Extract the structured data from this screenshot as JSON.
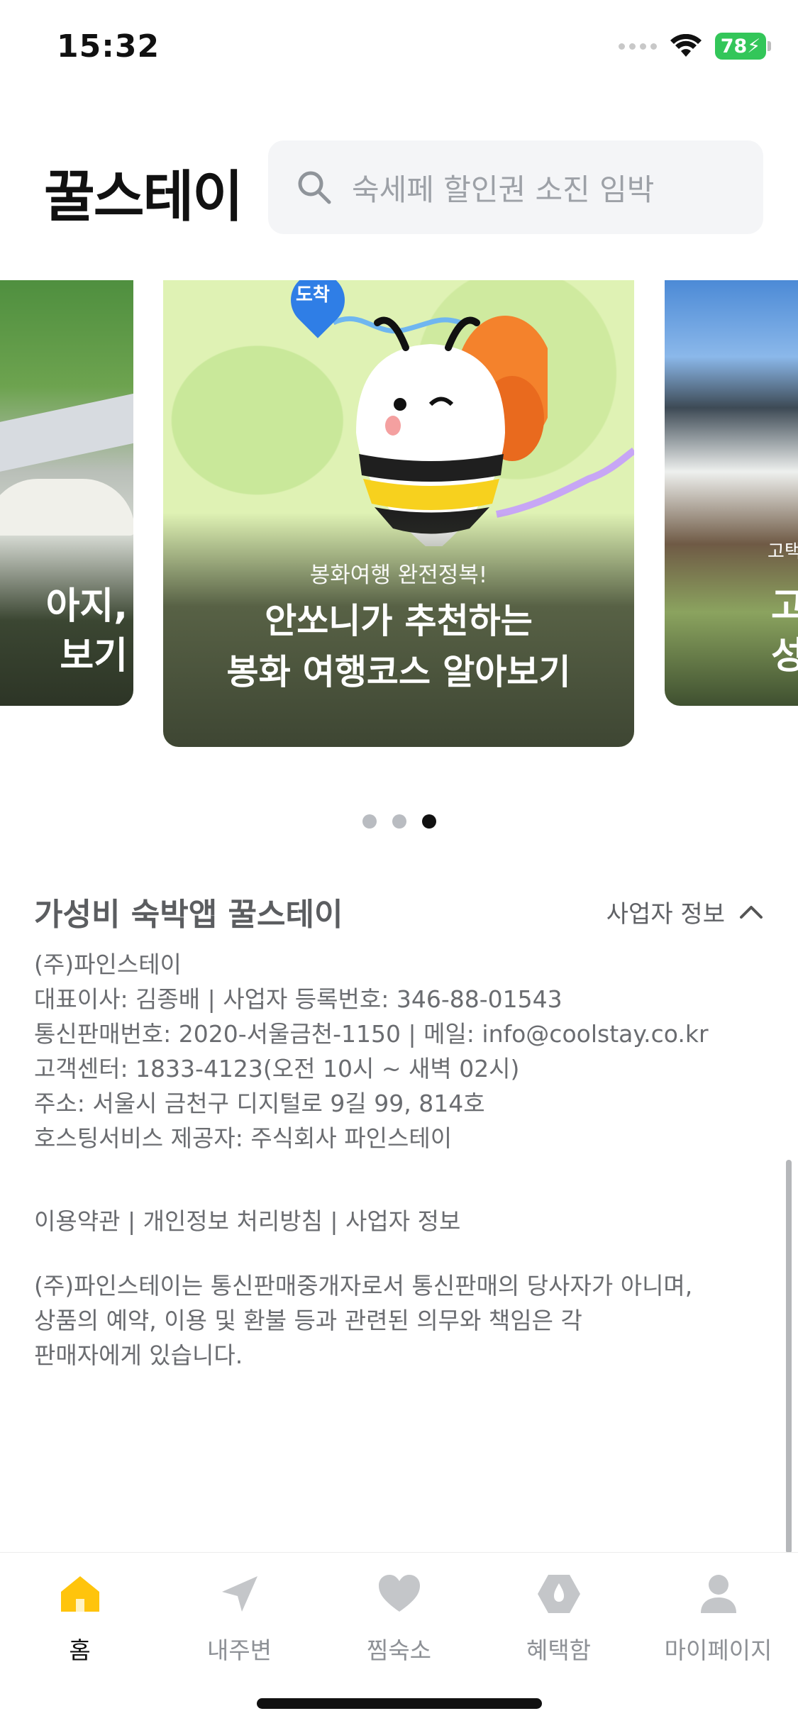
{
  "status_bar": {
    "time": "15:32",
    "battery": "78"
  },
  "header": {
    "logo": "꿀스테이",
    "search_placeholder": "숙세페 할인권 소진 임박"
  },
  "carousel": {
    "left_card_text": "아지,\n보기",
    "center_card": {
      "pin_label": "도착",
      "subtitle": "봉화여행 완전정복!",
      "title_line1": "안쏘니가 추천하는",
      "title_line2": "봉화 여행코스 알아보기"
    },
    "right_card_small": "고택",
    "right_card_text": "고\n성",
    "dots": 3,
    "active_dot": 3
  },
  "company": {
    "title": "가성비 숙박앱 꿀스테이",
    "toggle_label": "사업자 정보",
    "lines": [
      "(주)파인스테이",
      "대표이사: 김종배 | 사업자 등록번호: 346-88-01543",
      "통신판매번호: 2020-서울금천-1150 | 메일: info@coolstay.co.kr",
      "고객센터: 1833-4123(오전 10시 ~ 새벽 02시)",
      "주소: 서울시 금천구 디지털로 9길 99, 814호",
      "호스팅서비스 제공자: 주식회사 파인스테이"
    ],
    "links": [
      "이용약관",
      "개인정보 처리방침",
      "사업자 정보"
    ],
    "link_separator": " | ",
    "disclaimer_lines": [
      "(주)파인스테이는 통신판매중개자로서 통신판매의 당사자가 아니며,",
      "상품의 예약, 이용 및 환불 등과 관련된 의무와 책임은 각",
      "판매자에게 있습니다."
    ]
  },
  "tabbar": {
    "tabs": [
      {
        "label": "홈",
        "icon": "home-icon",
        "active": true
      },
      {
        "label": "내주변",
        "icon": "location-arrow-icon",
        "active": false
      },
      {
        "label": "찜숙소",
        "icon": "heart-icon",
        "active": false
      },
      {
        "label": "혜택함",
        "icon": "benefit-icon",
        "active": false
      },
      {
        "label": "마이페이지",
        "icon": "person-icon",
        "active": false
      }
    ],
    "active_color": "#ffc40c",
    "inactive_color": "#c4c6c9"
  }
}
